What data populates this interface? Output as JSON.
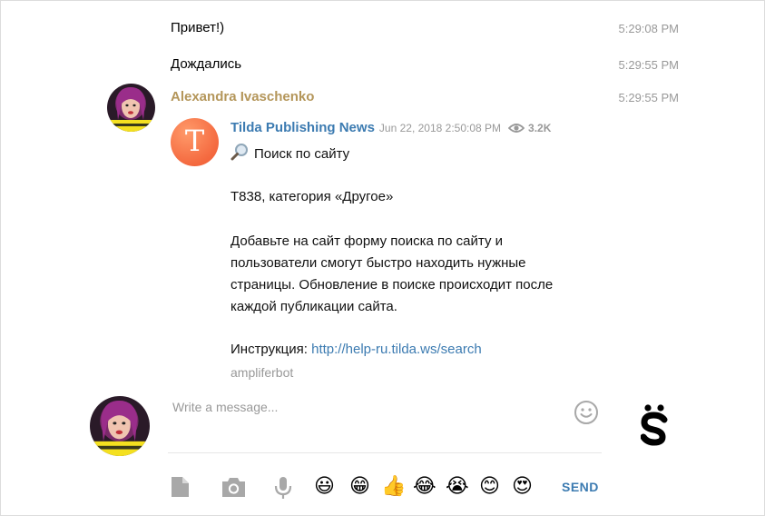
{
  "messages": [
    {
      "text": "Привет!)",
      "time": "5:29:08 PM"
    },
    {
      "text": "Дождались",
      "time": "5:29:55 PM"
    }
  ],
  "post": {
    "sender": "Alexandra Ivaschenko",
    "time": "5:29:55 PM",
    "forward": {
      "channel": "Tilda Publishing News",
      "avatar_letter": "T",
      "date": "Jun 22, 2018 2:50:08 PM",
      "views": "3.2K",
      "title": "Поиск по сайту",
      "line1": "T838, категория «Другое»",
      "para1": "Добавьте на сайт форму поиска по сайту и",
      "para2": "пользователи смогут быстро находить нужные",
      "para3": "страницы. Обновление в поиске происходит после",
      "para4": "каждой публикации сайта.",
      "instr_label": "Инструкция:",
      "link": "http://help-ru.tilda.ws/search",
      "via": "ampliferbot"
    }
  },
  "compose": {
    "placeholder": "Write a message...",
    "send_label": "SEND"
  },
  "emoji_bar": [
    "😃",
    "😁",
    "👍",
    "😂",
    "😭",
    "😊",
    "😍"
  ],
  "colors": {
    "accent": "#3c7bb1",
    "sender": "#b4965a",
    "time": "#999999"
  }
}
